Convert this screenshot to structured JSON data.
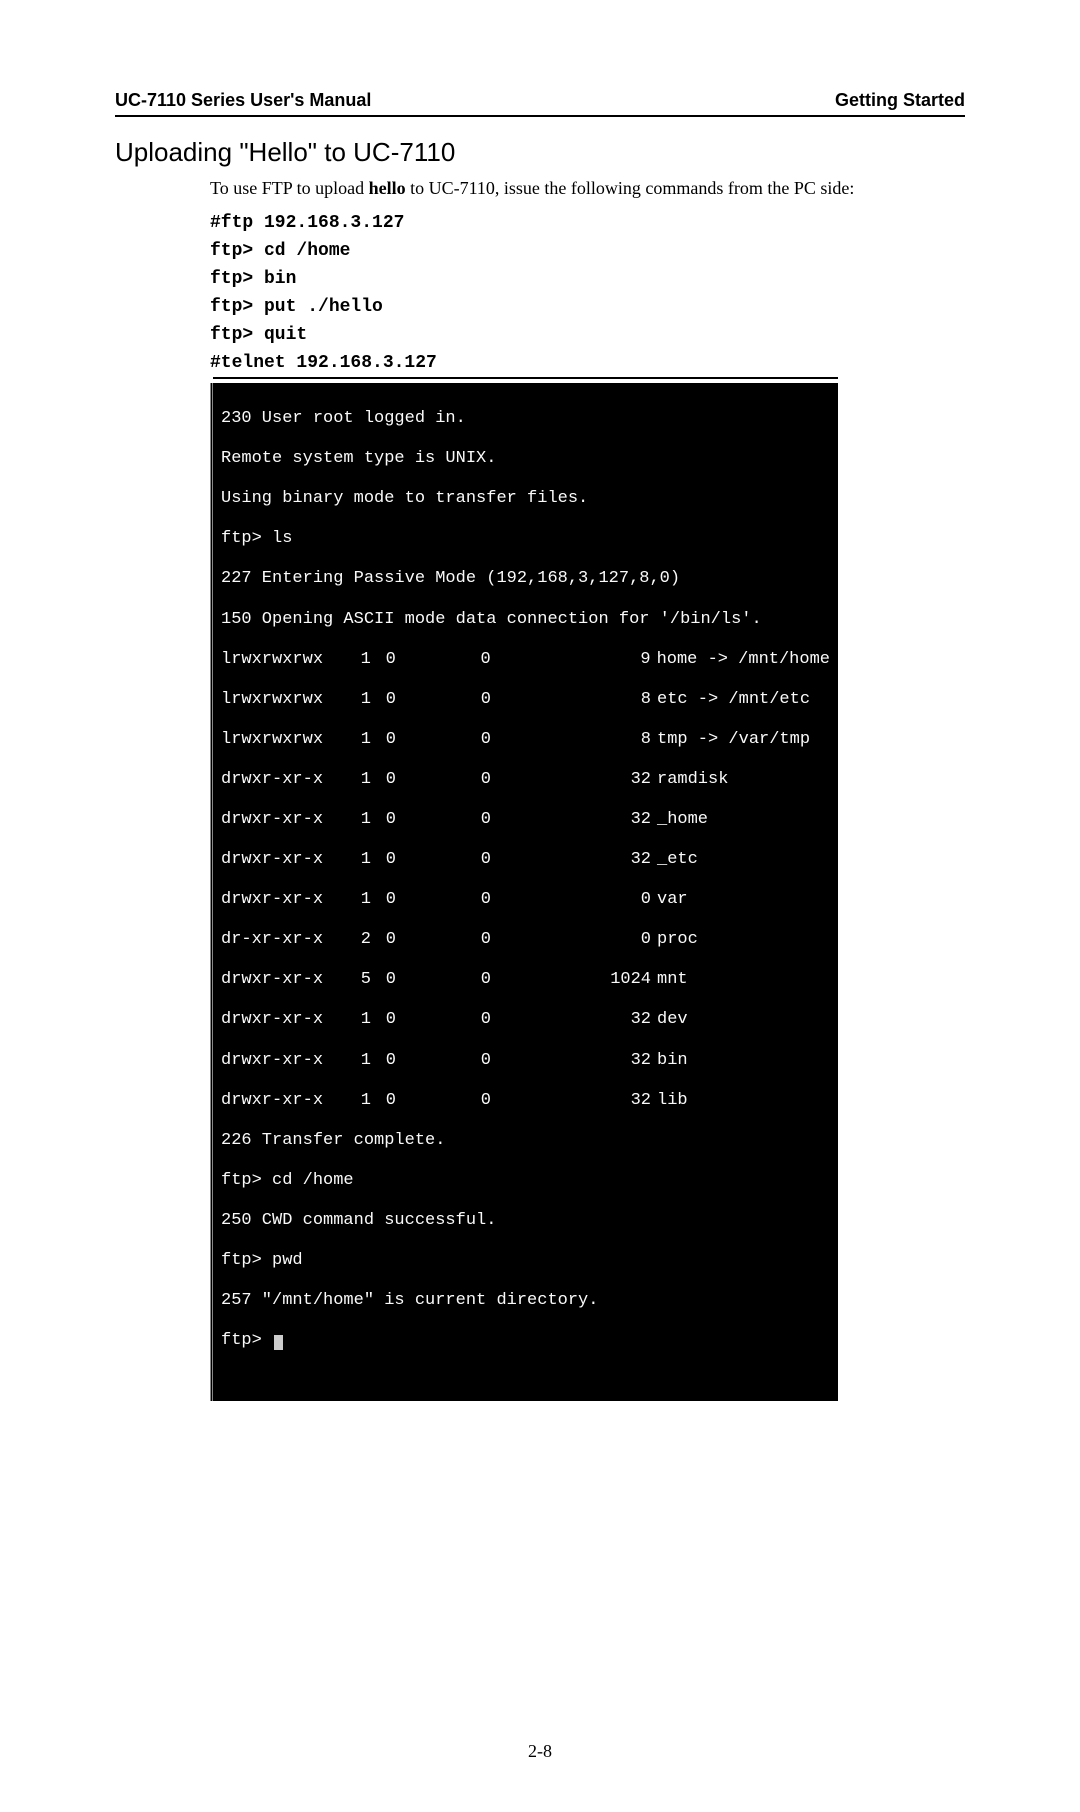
{
  "header": {
    "left": "UC-7110 Series User's Manual",
    "right": "Getting Started"
  },
  "section_title": "Uploading \"Hello\" to UC-7110",
  "intro": {
    "pre": "To use FTP to upload ",
    "bold": "hello",
    "post": " to UC-7110, issue the following commands from the PC side:"
  },
  "commands": [
    "#ftp 192.168.3.127",
    "ftp> cd /home",
    "ftp> bin",
    "ftp> put ./hello",
    "ftp> quit",
    "#telnet 192.168.3.127"
  ],
  "terminal": {
    "header_lines": [
      "230 User root logged in.",
      "Remote system type is UNIX.",
      "Using binary mode to transfer files.",
      "ftp> ls",
      "227 Entering Passive Mode (192,168,3,127,8,0)",
      "150 Opening ASCII mode data connection for '/bin/ls'."
    ],
    "rows": [
      {
        "perm": "lrwxrwxrwx",
        "links": "1",
        "owner": "0",
        "group": "0",
        "size": "9",
        "name": "home -> /mnt/home"
      },
      {
        "perm": "lrwxrwxrwx",
        "links": "1",
        "owner": "0",
        "group": "0",
        "size": "8",
        "name": "etc -> /mnt/etc"
      },
      {
        "perm": "lrwxrwxrwx",
        "links": "1",
        "owner": "0",
        "group": "0",
        "size": "8",
        "name": "tmp -> /var/tmp"
      },
      {
        "perm": "drwxr-xr-x",
        "links": "1",
        "owner": "0",
        "group": "0",
        "size": "32",
        "name": "ramdisk"
      },
      {
        "perm": "drwxr-xr-x",
        "links": "1",
        "owner": "0",
        "group": "0",
        "size": "32",
        "name": "_home"
      },
      {
        "perm": "drwxr-xr-x",
        "links": "1",
        "owner": "0",
        "group": "0",
        "size": "32",
        "name": "_etc"
      },
      {
        "perm": "drwxr-xr-x",
        "links": "1",
        "owner": "0",
        "group": "0",
        "size": "0",
        "name": "var"
      },
      {
        "perm": "dr-xr-xr-x",
        "links": "2",
        "owner": "0",
        "group": "0",
        "size": "0",
        "name": "proc"
      },
      {
        "perm": "drwxr-xr-x",
        "links": "5",
        "owner": "0",
        "group": "0",
        "size": "1024",
        "name": "mnt"
      },
      {
        "perm": "drwxr-xr-x",
        "links": "1",
        "owner": "0",
        "group": "0",
        "size": "32",
        "name": "dev"
      },
      {
        "perm": "drwxr-xr-x",
        "links": "1",
        "owner": "0",
        "group": "0",
        "size": "32",
        "name": "bin"
      },
      {
        "perm": "drwxr-xr-x",
        "links": "1",
        "owner": "0",
        "group": "0",
        "size": "32",
        "name": "lib"
      }
    ],
    "footer_lines": [
      "226 Transfer complete.",
      "ftp> cd /home",
      "250 CWD command successful.",
      "ftp> pwd",
      "257 \"/mnt/home\" is current directory."
    ],
    "prompt": "ftp> "
  },
  "page_number": "2-8"
}
